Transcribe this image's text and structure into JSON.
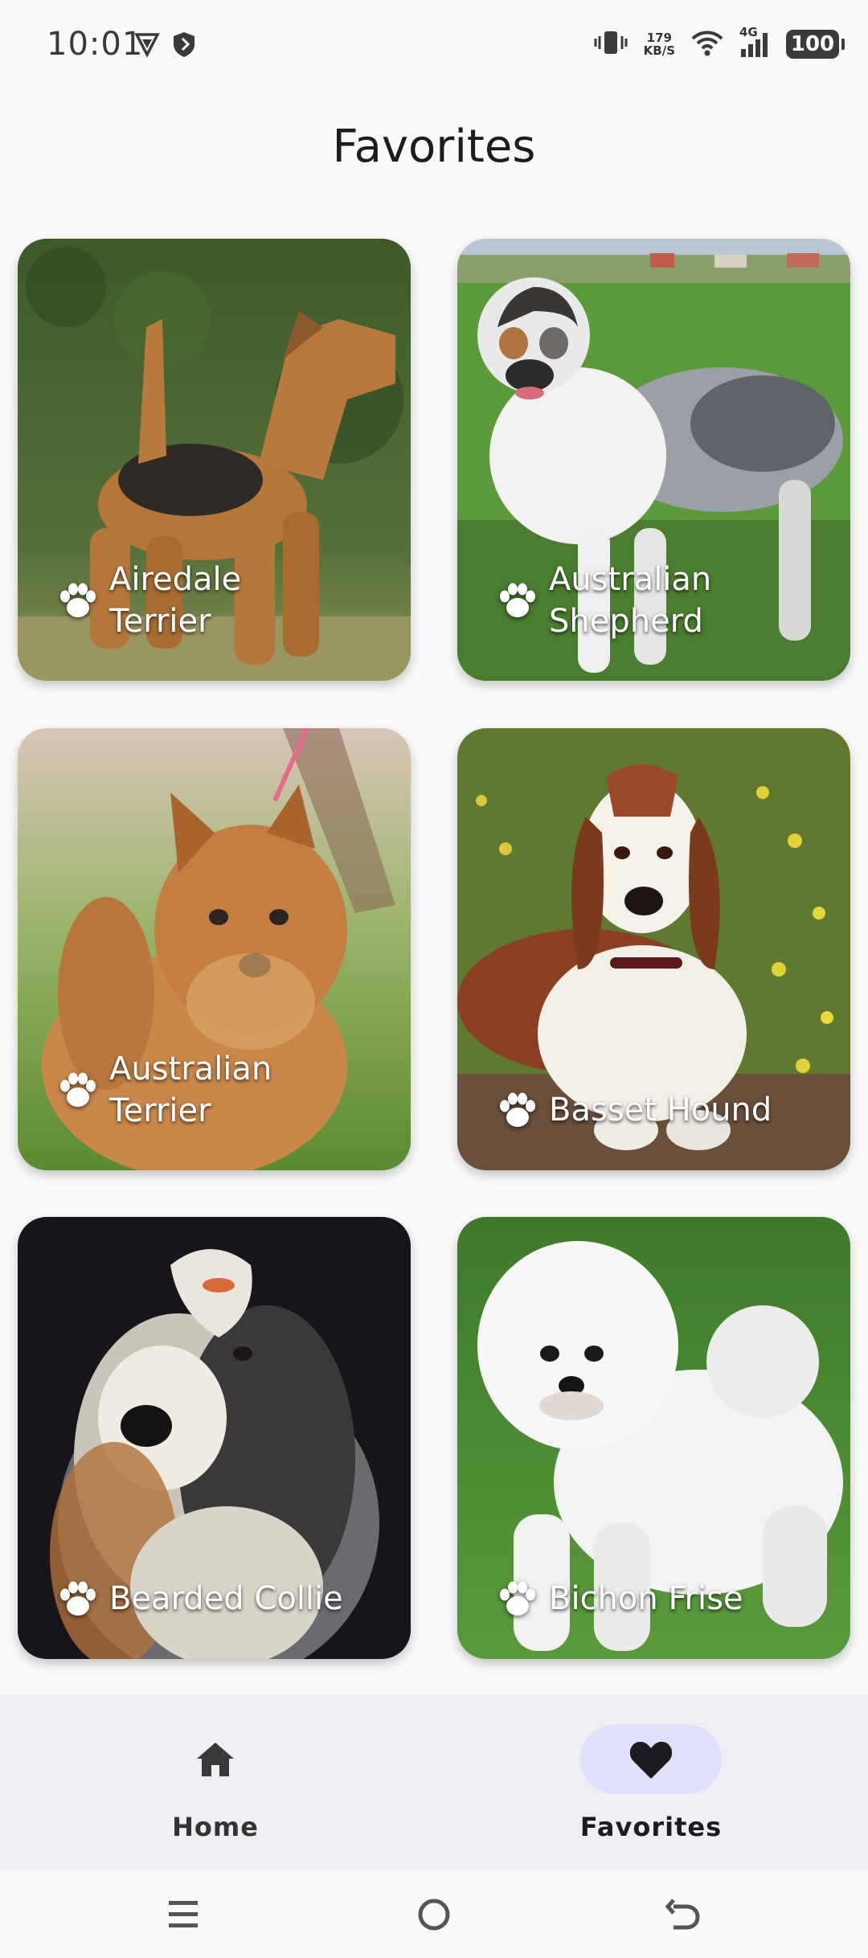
{
  "status_bar": {
    "time": "10:01",
    "net_speed_value": "179",
    "net_speed_unit": "KB/S",
    "signal_label": "4G",
    "battery": "100",
    "icons": [
      "vpn-shield-icon",
      "security-shield-icon",
      "vibrate-icon",
      "wifi-icon",
      "cell-signal-icon",
      "battery-icon"
    ]
  },
  "page": {
    "title": "Favorites"
  },
  "favorites": [
    {
      "name": "Airedale Terrier",
      "icon": "paw-icon"
    },
    {
      "name": "Australian Shepherd",
      "icon": "paw-icon"
    },
    {
      "name": "Australian Terrier",
      "icon": "paw-icon"
    },
    {
      "name": "Basset Hound",
      "icon": "paw-icon"
    },
    {
      "name": "Bearded Collie",
      "icon": "paw-icon"
    },
    {
      "name": "Bichon Frise",
      "icon": "paw-icon"
    }
  ],
  "bottom_nav": {
    "items": [
      {
        "label": "Home",
        "icon": "home-icon",
        "active": false
      },
      {
        "label": "Favorites",
        "icon": "heart-icon",
        "active": true
      }
    ]
  },
  "system_nav": {
    "icons": [
      "menu-icon",
      "home-circle-icon",
      "back-icon"
    ]
  },
  "colors": {
    "active_pill": "#dfe1fb",
    "nav_background": "#efeef2",
    "background": "#fafafa"
  }
}
